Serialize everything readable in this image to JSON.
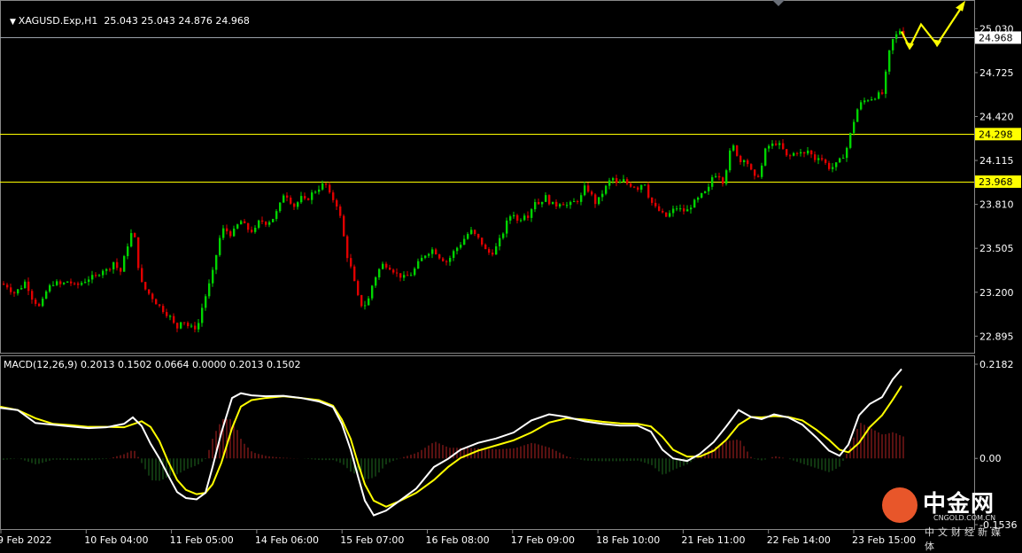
{
  "symbol_info": "XAGUSD.Exp,H1  25.043 25.043 24.876 24.968",
  "macd_info": "MACD(12,26,9) 0.2013 0.1502 0.0664 0.0000 0.2013 0.1502",
  "watermark": {
    "title": "中金网",
    "sub": "CNGOLD.COM.CN",
    "cn": "中文财经新媒体"
  },
  "colors": {
    "bull": "#00d400",
    "bear": "#e00000",
    "level": "#ffff00",
    "last": "#9aa0a8",
    "macd_main": "#ffffff",
    "macd_signal": "#ffff00",
    "hist_pos": "#b22222",
    "hist_neg": "#1f6b1f"
  },
  "chart_data": [
    {
      "type": "candlestick",
      "ylim": [
        22.78,
        25.18
      ],
      "y_ticks": [
        "25.030",
        "24.725",
        "24.420",
        "24.115",
        "23.810",
        "23.505",
        "23.200",
        "22.895"
      ],
      "x_ticks": [
        "9 Feb 2022",
        "10 Feb 04:00",
        "11 Feb 05:00",
        "14 Feb 06:00",
        "15 Feb 07:00",
        "16 Feb 08:00",
        "17 Feb 09:00",
        "18 Feb 10:00",
        "21 Feb 11:00",
        "22 Feb 14:00",
        "23 Feb 15:00"
      ],
      "close_path": [
        [
          0,
          23.26
        ],
        [
          8,
          23.24
        ],
        [
          14,
          23.19
        ],
        [
          22,
          23.23
        ],
        [
          28,
          23.28
        ],
        [
          34,
          23.17
        ],
        [
          44,
          23.09
        ],
        [
          52,
          23.22
        ],
        [
          60,
          23.27
        ],
        [
          68,
          23.25
        ],
        [
          76,
          23.28
        ],
        [
          84,
          23.24
        ],
        [
          92,
          23.27
        ],
        [
          100,
          23.3
        ],
        [
          108,
          23.31
        ],
        [
          114,
          23.36
        ],
        [
          120,
          23.35
        ],
        [
          128,
          23.42
        ],
        [
          134,
          23.32
        ],
        [
          140,
          23.46
        ],
        [
          146,
          23.6
        ],
        [
          150,
          23.62
        ],
        [
          154,
          23.42
        ],
        [
          158,
          23.27
        ],
        [
          164,
          23.21
        ],
        [
          170,
          23.17
        ],
        [
          176,
          23.12
        ],
        [
          184,
          23.07
        ],
        [
          192,
          23.02
        ],
        [
          198,
          22.94
        ],
        [
          204,
          23.02
        ],
        [
          210,
          22.97
        ],
        [
          216,
          22.95
        ],
        [
          222,
          22.96
        ],
        [
          228,
          23.12
        ],
        [
          234,
          23.23
        ],
        [
          240,
          23.36
        ],
        [
          246,
          23.56
        ],
        [
          252,
          23.65
        ],
        [
          258,
          23.6
        ],
        [
          264,
          23.63
        ],
        [
          270,
          23.7
        ],
        [
          278,
          23.64
        ],
        [
          286,
          23.62
        ],
        [
          292,
          23.7
        ],
        [
          300,
          23.68
        ],
        [
          308,
          23.72
        ],
        [
          314,
          23.79
        ],
        [
          320,
          23.9
        ],
        [
          326,
          23.84
        ],
        [
          332,
          23.79
        ],
        [
          338,
          23.86
        ],
        [
          344,
          23.83
        ],
        [
          350,
          23.88
        ],
        [
          356,
          23.91
        ],
        [
          362,
          23.94
        ],
        [
          366,
          23.96
        ],
        [
          372,
          23.86
        ],
        [
          378,
          23.83
        ],
        [
          384,
          23.7
        ],
        [
          390,
          23.47
        ],
        [
          396,
          23.35
        ],
        [
          402,
          23.18
        ],
        [
          408,
          23.1
        ],
        [
          414,
          23.13
        ],
        [
          420,
          23.27
        ],
        [
          426,
          23.35
        ],
        [
          432,
          23.4
        ],
        [
          440,
          23.37
        ],
        [
          448,
          23.32
        ],
        [
          456,
          23.3
        ],
        [
          464,
          23.33
        ],
        [
          472,
          23.41
        ],
        [
          480,
          23.47
        ],
        [
          488,
          23.5
        ],
        [
          496,
          23.44
        ],
        [
          504,
          23.41
        ],
        [
          512,
          23.49
        ],
        [
          518,
          23.53
        ],
        [
          524,
          23.58
        ],
        [
          530,
          23.63
        ],
        [
          536,
          23.59
        ],
        [
          542,
          23.55
        ],
        [
          548,
          23.48
        ],
        [
          554,
          23.47
        ],
        [
          560,
          23.52
        ],
        [
          566,
          23.6
        ],
        [
          572,
          23.7
        ],
        [
          578,
          23.76
        ],
        [
          584,
          23.68
        ],
        [
          590,
          23.75
        ],
        [
          596,
          23.73
        ],
        [
          602,
          23.84
        ],
        [
          608,
          23.81
        ],
        [
          614,
          23.87
        ],
        [
          620,
          23.82
        ],
        [
          626,
          23.8
        ],
        [
          632,
          23.83
        ],
        [
          640,
          23.8
        ],
        [
          648,
          23.83
        ],
        [
          654,
          23.85
        ],
        [
          660,
          23.94
        ],
        [
          666,
          23.88
        ],
        [
          672,
          23.81
        ],
        [
          678,
          23.88
        ],
        [
          684,
          23.94
        ],
        [
          690,
          24.0
        ],
        [
          696,
          23.94
        ],
        [
          702,
          23.98
        ],
        [
          708,
          23.95
        ],
        [
          714,
          23.94
        ],
        [
          720,
          23.92
        ],
        [
          726,
          23.98
        ],
        [
          732,
          23.85
        ],
        [
          738,
          23.79
        ],
        [
          744,
          23.76
        ],
        [
          750,
          23.72
        ],
        [
          756,
          23.75
        ],
        [
          762,
          23.79
        ],
        [
          768,
          23.77
        ],
        [
          774,
          23.76
        ],
        [
          780,
          23.81
        ],
        [
          786,
          23.84
        ],
        [
          792,
          23.88
        ],
        [
          798,
          23.9
        ],
        [
          804,
          24.02
        ],
        [
          810,
          24.02
        ],
        [
          816,
          23.96
        ],
        [
          822,
          24.16
        ],
        [
          828,
          24.22
        ],
        [
          834,
          24.1
        ],
        [
          840,
          24.14
        ],
        [
          846,
          24.05
        ],
        [
          852,
          23.98
        ],
        [
          858,
          24.05
        ],
        [
          864,
          24.21
        ],
        [
          870,
          24.22
        ],
        [
          876,
          24.24
        ],
        [
          882,
          24.2
        ],
        [
          888,
          24.13
        ],
        [
          894,
          24.16
        ],
        [
          900,
          24.18
        ],
        [
          906,
          24.15
        ],
        [
          912,
          24.19
        ],
        [
          918,
          24.12
        ],
        [
          924,
          24.15
        ],
        [
          930,
          24.1
        ],
        [
          936,
          24.06
        ],
        [
          942,
          24.08
        ],
        [
          948,
          24.12
        ],
        [
          954,
          24.18
        ],
        [
          960,
          24.32
        ],
        [
          966,
          24.46
        ],
        [
          972,
          24.52
        ],
        [
          978,
          24.54
        ],
        [
          984,
          24.55
        ],
        [
          990,
          24.57
        ],
        [
          996,
          24.58
        ],
        [
          1000,
          24.76
        ],
        [
          1004,
          24.9
        ],
        [
          1008,
          24.97
        ],
        [
          1012,
          24.99
        ],
        [
          1016,
          25.03
        ],
        [
          1020,
          24.968
        ]
      ],
      "levels": [
        24.968,
        24.298,
        23.968
      ],
      "level_labels": [
        "24.968",
        "24.298",
        "23.968"
      ],
      "last_price": 24.968,
      "projection": [
        [
          1018,
          25.01
        ],
        [
          1027,
          24.9
        ],
        [
          1040,
          25.06
        ],
        [
          1058,
          24.92
        ],
        [
          1088,
          25.2
        ]
      ]
    },
    {
      "type": "line+bar",
      "name": "MACD(12,26,9)",
      "ylim": [
        -0.1536,
        0.2182
      ],
      "y_ticks": [
        "0.2182",
        "0.00",
        "-0.1536"
      ],
      "main": [
        [
          0,
          0.117
        ],
        [
          20,
          0.112
        ],
        [
          40,
          0.082
        ],
        [
          60,
          0.078
        ],
        [
          80,
          0.074
        ],
        [
          100,
          0.07
        ],
        [
          120,
          0.072
        ],
        [
          140,
          0.08
        ],
        [
          150,
          0.095
        ],
        [
          160,
          0.075
        ],
        [
          170,
          0.034
        ],
        [
          180,
          0.0
        ],
        [
          190,
          -0.04
        ],
        [
          200,
          -0.078
        ],
        [
          210,
          -0.092
        ],
        [
          222,
          -0.095
        ],
        [
          232,
          -0.08
        ],
        [
          240,
          -0.02
        ],
        [
          250,
          0.06
        ],
        [
          262,
          0.14
        ],
        [
          272,
          0.151
        ],
        [
          284,
          0.146
        ],
        [
          300,
          0.144
        ],
        [
          320,
          0.145
        ],
        [
          340,
          0.14
        ],
        [
          360,
          0.132
        ],
        [
          376,
          0.119
        ],
        [
          386,
          0.08
        ],
        [
          396,
          0.02
        ],
        [
          404,
          -0.04
        ],
        [
          412,
          -0.098
        ],
        [
          422,
          -0.132
        ],
        [
          436,
          -0.121
        ],
        [
          450,
          -0.1
        ],
        [
          470,
          -0.07
        ],
        [
          490,
          -0.02
        ],
        [
          506,
          -0.001
        ],
        [
          520,
          0.02
        ],
        [
          540,
          0.036
        ],
        [
          560,
          0.046
        ],
        [
          580,
          0.06
        ],
        [
          600,
          0.088
        ],
        [
          620,
          0.102
        ],
        [
          640,
          0.096
        ],
        [
          660,
          0.086
        ],
        [
          680,
          0.08
        ],
        [
          700,
          0.076
        ],
        [
          720,
          0.076
        ],
        [
          735,
          0.062
        ],
        [
          748,
          0.02
        ],
        [
          760,
          0.0
        ],
        [
          776,
          -0.006
        ],
        [
          790,
          0.01
        ],
        [
          806,
          0.038
        ],
        [
          820,
          0.074
        ],
        [
          834,
          0.112
        ],
        [
          848,
          0.096
        ],
        [
          860,
          0.091
        ],
        [
          874,
          0.102
        ],
        [
          890,
          0.095
        ],
        [
          906,
          0.078
        ],
        [
          922,
          0.048
        ],
        [
          936,
          0.018
        ],
        [
          948,
          0.006
        ],
        [
          958,
          0.032
        ],
        [
          970,
          0.1
        ],
        [
          982,
          0.126
        ],
        [
          996,
          0.142
        ],
        [
          1008,
          0.183
        ],
        [
          1018,
          0.207
        ]
      ],
      "signal": [
        [
          0,
          0.12
        ],
        [
          20,
          0.112
        ],
        [
          40,
          0.093
        ],
        [
          60,
          0.08
        ],
        [
          80,
          0.077
        ],
        [
          100,
          0.073
        ],
        [
          120,
          0.073
        ],
        [
          140,
          0.072
        ],
        [
          160,
          0.086
        ],
        [
          170,
          0.073
        ],
        [
          180,
          0.04
        ],
        [
          190,
          -0.008
        ],
        [
          200,
          -0.05
        ],
        [
          210,
          -0.073
        ],
        [
          222,
          -0.083
        ],
        [
          232,
          -0.08
        ],
        [
          240,
          -0.06
        ],
        [
          250,
          -0.01
        ],
        [
          262,
          0.07
        ],
        [
          272,
          0.12
        ],
        [
          284,
          0.135
        ],
        [
          300,
          0.14
        ],
        [
          320,
          0.144
        ],
        [
          340,
          0.14
        ],
        [
          360,
          0.135
        ],
        [
          376,
          0.122
        ],
        [
          386,
          0.09
        ],
        [
          396,
          0.045
        ],
        [
          404,
          -0.01
        ],
        [
          412,
          -0.06
        ],
        [
          422,
          -0.098
        ],
        [
          436,
          -0.112
        ],
        [
          450,
          -0.1
        ],
        [
          470,
          -0.08
        ],
        [
          490,
          -0.05
        ],
        [
          506,
          -0.02
        ],
        [
          520,
          0.001
        ],
        [
          540,
          0.018
        ],
        [
          560,
          0.03
        ],
        [
          580,
          0.042
        ],
        [
          600,
          0.06
        ],
        [
          620,
          0.083
        ],
        [
          640,
          0.093
        ],
        [
          660,
          0.09
        ],
        [
          680,
          0.085
        ],
        [
          700,
          0.081
        ],
        [
          720,
          0.08
        ],
        [
          735,
          0.074
        ],
        [
          748,
          0.05
        ],
        [
          760,
          0.02
        ],
        [
          776,
          0.004
        ],
        [
          790,
          0.004
        ],
        [
          806,
          0.018
        ],
        [
          820,
          0.043
        ],
        [
          834,
          0.078
        ],
        [
          848,
          0.096
        ],
        [
          860,
          0.095
        ],
        [
          874,
          0.098
        ],
        [
          890,
          0.096
        ],
        [
          906,
          0.088
        ],
        [
          922,
          0.066
        ],
        [
          936,
          0.043
        ],
        [
          948,
          0.02
        ],
        [
          958,
          0.014
        ],
        [
          970,
          0.036
        ],
        [
          982,
          0.072
        ],
        [
          996,
          0.1
        ],
        [
          1008,
          0.136
        ],
        [
          1018,
          0.168
        ]
      ]
    }
  ]
}
